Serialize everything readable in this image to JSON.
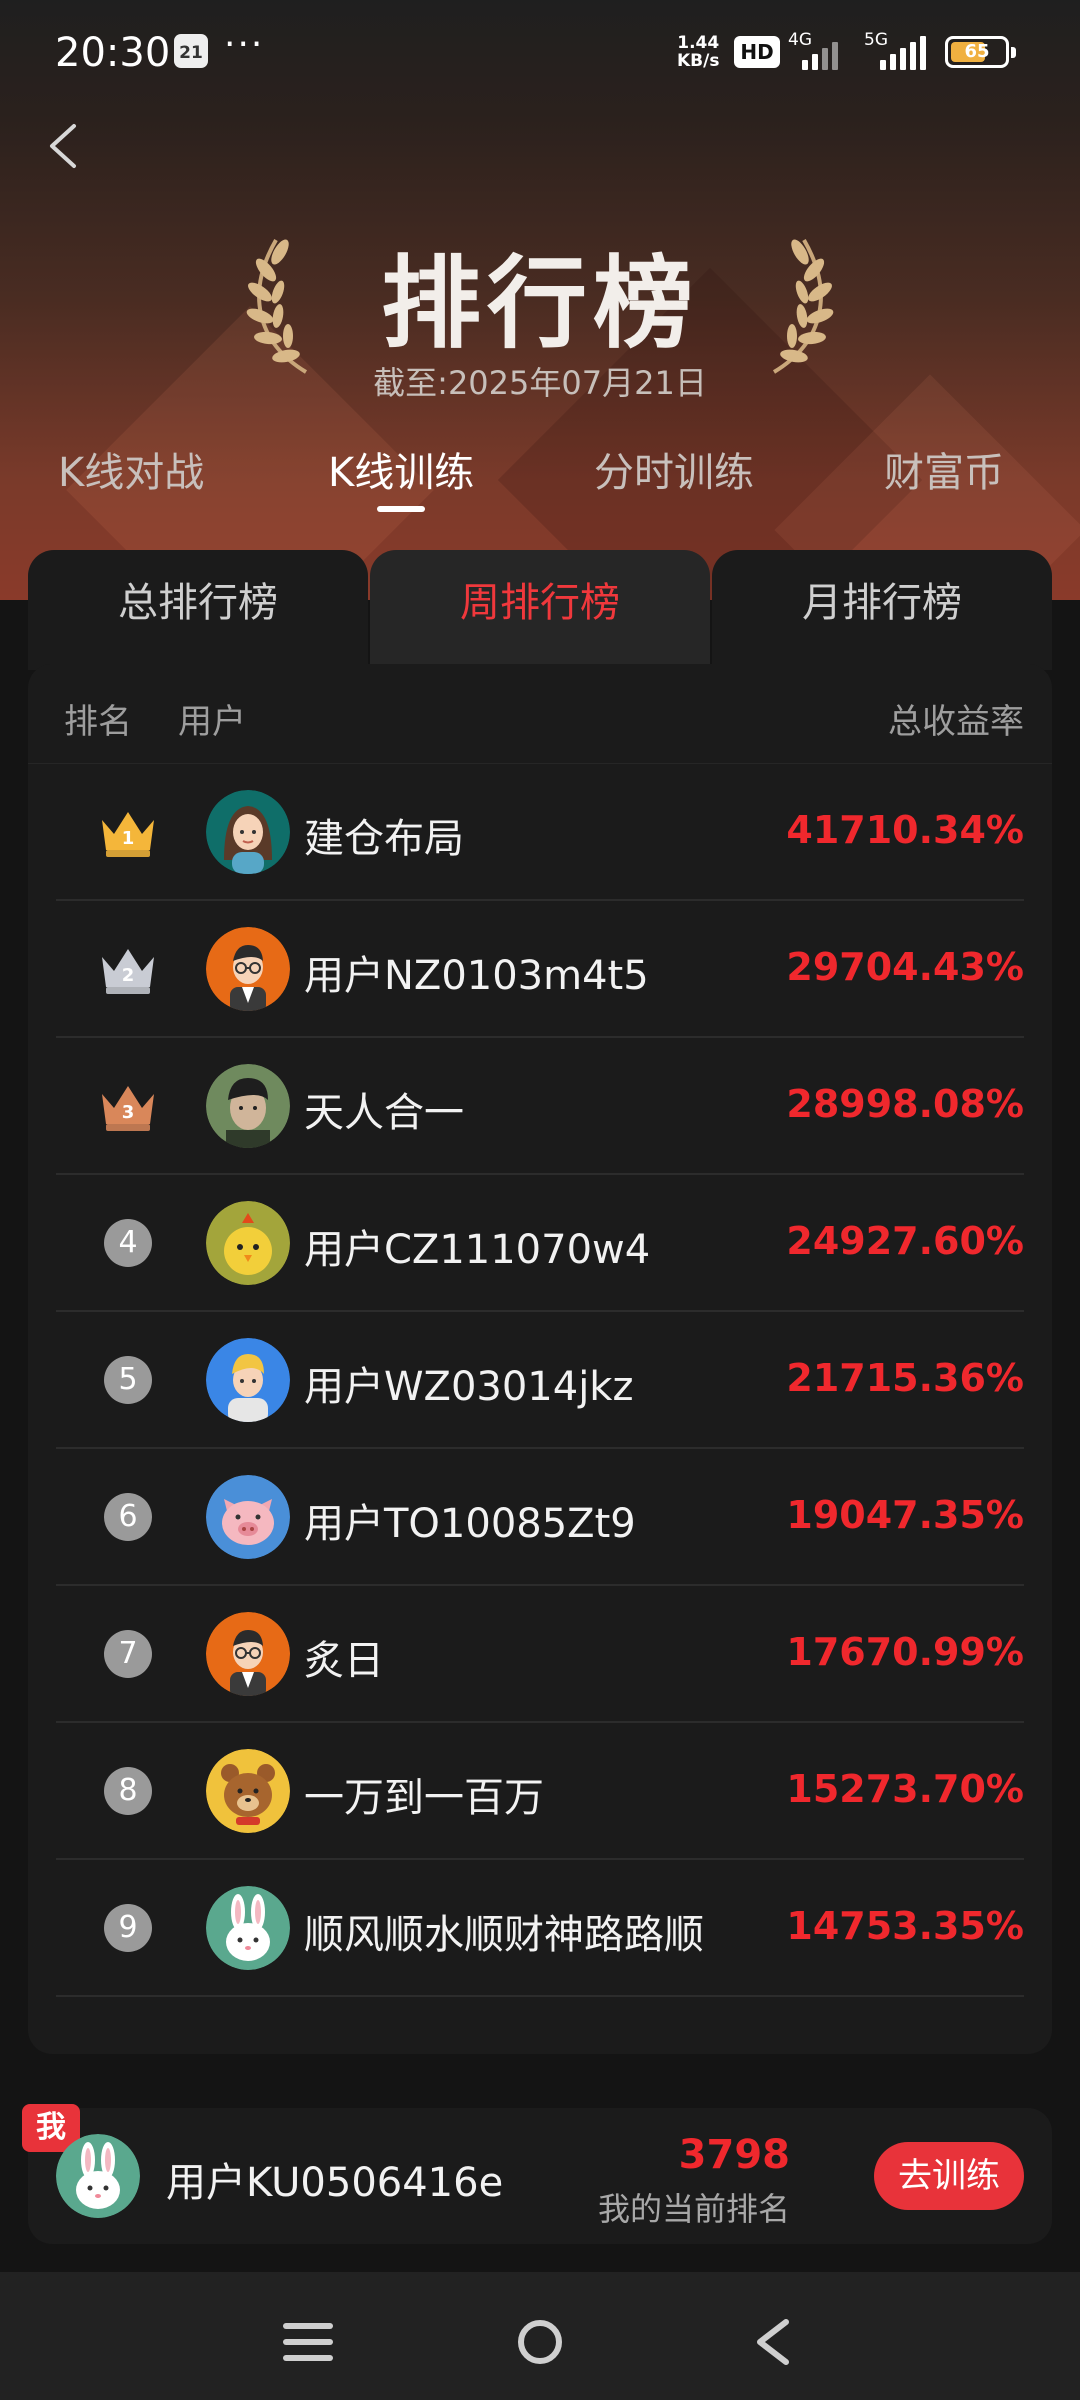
{
  "status_bar": {
    "time": "20:30",
    "calendar_day": "21",
    "more": "···",
    "net_speed_value": "1.44",
    "net_speed_unit": "KB/s",
    "hd_label": "HD",
    "sim1_label": "4G",
    "sim2_label": "5G",
    "battery_level": "65"
  },
  "header": {
    "title": "排行榜",
    "date": "截至:2025年07月21日"
  },
  "main_tabs": [
    {
      "label": "K线对战"
    },
    {
      "label": "K线训练"
    },
    {
      "label": "分时训练"
    },
    {
      "label": "财富币"
    }
  ],
  "active_main_tab": "K线训练",
  "sub_tabs": [
    {
      "label": "总排行榜"
    },
    {
      "label": "周排行榜"
    },
    {
      "label": "月排行榜"
    }
  ],
  "active_sub_tab": "周排行榜",
  "board": {
    "col_rank": "排名",
    "col_user": "用户",
    "col_return": "总收益率",
    "rows": [
      {
        "rank": "1",
        "name": "建仓布局",
        "ret": "41710.34%",
        "avatar": "woman-avatar"
      },
      {
        "rank": "2",
        "name": "用户NZ0103m4t5",
        "ret": "29704.43%",
        "avatar": "glasses-man-avatar"
      },
      {
        "rank": "3",
        "name": "天人合一",
        "ret": "28998.08%",
        "avatar": "photo-avatar"
      },
      {
        "rank": "4",
        "name": "用户CZ111070w4",
        "ret": "24927.60%",
        "avatar": "chick-avatar"
      },
      {
        "rank": "5",
        "name": "用户WZ03014jkz",
        "ret": "21715.36%",
        "avatar": "blond-man-avatar"
      },
      {
        "rank": "6",
        "name": "用户TO10085Zt9",
        "ret": "19047.35%",
        "avatar": "pig-avatar"
      },
      {
        "rank": "7",
        "name": "炙日",
        "ret": "17670.99%",
        "avatar": "glasses-man-avatar"
      },
      {
        "rank": "8",
        "name": "一万到一百万",
        "ret": "15273.70%",
        "avatar": "bear-avatar"
      },
      {
        "rank": "9",
        "name": "顺风顺水顺财神路路顺",
        "ret": "14753.35%",
        "avatar": "rabbit-avatar"
      }
    ]
  },
  "mine": {
    "badge": "我",
    "name": "用户KU0506416e",
    "rank": "3798",
    "rank_label": "我的当前排名",
    "button": "去训练"
  },
  "colors": {
    "accent_red": "#f0282d",
    "gold": "#f4b63a",
    "silver": "#c9ccd4",
    "bronze": "#d9875a"
  }
}
